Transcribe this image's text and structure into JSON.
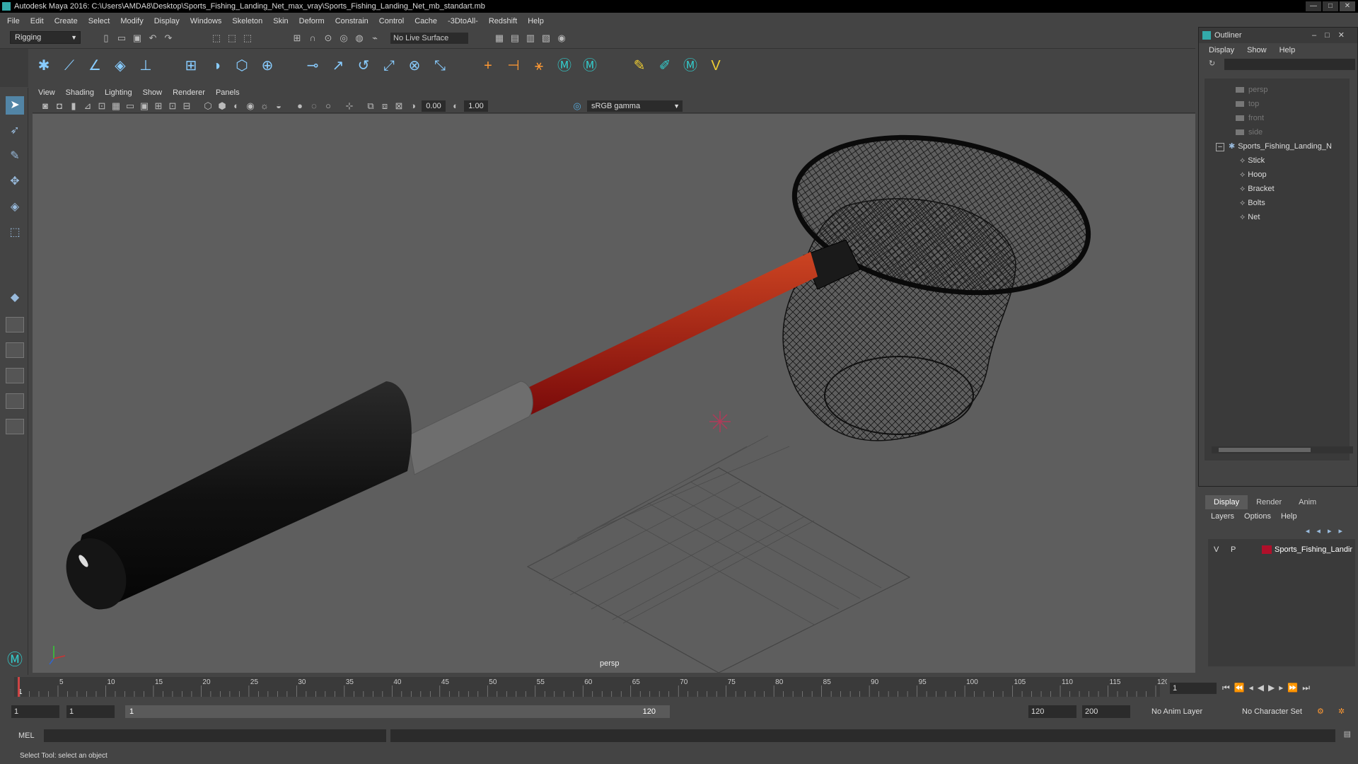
{
  "window": {
    "title": "Autodesk Maya 2016: C:\\Users\\AMDA8\\Desktop\\Sports_Fishing_Landing_Net_max_vray\\Sports_Fishing_Landing_Net_mb_standart.mb",
    "minimize": "—",
    "maximize": "□",
    "close": "✕"
  },
  "menubar": [
    "File",
    "Edit",
    "Create",
    "Select",
    "Modify",
    "Display",
    "Windows",
    "Skeleton",
    "Skin",
    "Deform",
    "Constrain",
    "Control",
    "Cache",
    "-3DtoAll-",
    "Redshift",
    "Help"
  ],
  "statusline": {
    "mode": "Rigging",
    "live_surface": "No Live Surface"
  },
  "viewport": {
    "menus": [
      "View",
      "Shading",
      "Lighting",
      "Show",
      "Renderer",
      "Panels"
    ],
    "field_near": "0.00",
    "field_far": "1.00",
    "color_space": "sRGB gamma",
    "camera_label": "persp"
  },
  "outliner": {
    "title": "Outliner",
    "menus": [
      "Display",
      "Show",
      "Help"
    ],
    "items": [
      {
        "label": "persp"
      },
      {
        "label": "top"
      },
      {
        "label": "front"
      },
      {
        "label": "side"
      },
      {
        "label": "Sports_Fishing_Landing_N"
      },
      {
        "label": "Stick"
      },
      {
        "label": "Hoop"
      },
      {
        "label": "Bracket"
      },
      {
        "label": "Bolts"
      },
      {
        "label": "Net"
      }
    ]
  },
  "layers": {
    "tabs": [
      "Display",
      "Render",
      "Anim"
    ],
    "menus": [
      "Layers",
      "Options",
      "Help"
    ],
    "row": {
      "v": "V",
      "p": "P",
      "name": "Sports_Fishing_Landir",
      "color": "#b0102a"
    }
  },
  "timeline": {
    "ticks": [
      "5",
      "10",
      "15",
      "20",
      "25",
      "30",
      "35",
      "40",
      "45",
      "50",
      "55",
      "60",
      "65",
      "70",
      "75",
      "80",
      "85",
      "90",
      "95",
      "100",
      "105",
      "110",
      "115",
      "120"
    ],
    "first": "1",
    "current_frame": "1"
  },
  "range": {
    "start": "1",
    "playback_start": "1",
    "slider_start": "1",
    "slider_end": "120",
    "playback_end": "120",
    "end": "200",
    "anim_layer": "No Anim Layer",
    "character_set": "No Character Set"
  },
  "command": {
    "label": "MEL"
  },
  "help_line": "Select Tool: select an object"
}
